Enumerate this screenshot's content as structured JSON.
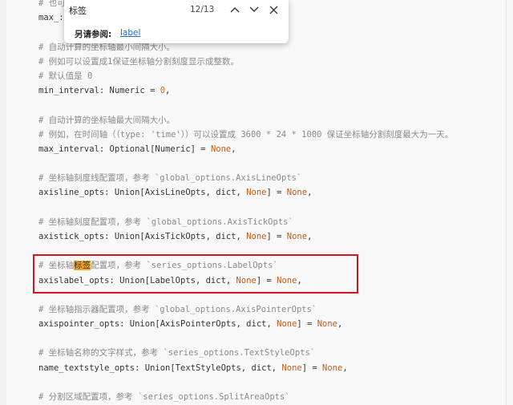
{
  "find_bar": {
    "query": "标签",
    "match_count": "12/13",
    "see_also_label": "另请参阅:",
    "see_also_link": "label"
  },
  "code": {
    "top_comment_prefix": "# 也可",
    "max_prefix": "max_:",
    "min_comment_1": "# 自动计算的坐标轴最小间隔大小。",
    "min_comment_2": "# 例如可以设置成1保证坐标轴分割刻度显示成整数。",
    "min_comment_3": "# 默认值是 0",
    "min_code": {
      "a": "min_interval: Numeric = ",
      "num": "0",
      "b": ","
    },
    "max_comment_1": "# 自动计算的坐标轴最大间隔大小。",
    "max_comment_2": "# 例如，在时间轴（（type: 'time'））可以设置成 3600 * 24 * 1000 保证坐标轴分割刻度最大为一天。",
    "max_code": {
      "a": "max_interval: Optional[Numeric] = ",
      "kw": "None",
      "b": ","
    },
    "axisline_comment": "# 坐标轴刻度线配置项，参考 `global_options.AxisLineOpts`",
    "axisline_code": {
      "a": "axisline_opts: Union[AxisLineOpts, dict, ",
      "kw1": "None",
      "b": "] = ",
      "kw2": "None",
      "c": ","
    },
    "axistick_comment": "# 坐标轴刻度配置项，参考 `global_options.AxisTickOpts`",
    "axistick_code": {
      "a": "axistick_opts: Union[AxisTickOpts, dict, ",
      "kw1": "None",
      "b": "] = ",
      "kw2": "None",
      "c": ","
    },
    "axislabel_comment": {
      "a": "# 坐标轴",
      "hl": "标签",
      "b": "配置项，参考 `series_options.LabelOpts`"
    },
    "axislabel_code": {
      "a": "axislabel_opts: Union[LabelOpts, dict, ",
      "kw1": "None",
      "b": "] = ",
      "kw2": "None",
      "c": ","
    },
    "axispointer_comment": "# 坐标轴指示器配置项，参考 `global_options.AxisPointerOpts`",
    "axispointer_code": {
      "a": "axispointer_opts: Union[AxisPointerOpts, dict, ",
      "kw1": "None",
      "b": "] = ",
      "kw2": "None",
      "c": ","
    },
    "name_style_comment": "# 坐标轴名称的文字样式，参考 `series_options.TextStyleOpts`",
    "name_style_code": {
      "a": "name_textstyle_opts: Union[TextStyleOpts, dict, ",
      "kw1": "None",
      "b": "] = ",
      "kw2": "None",
      "c": ","
    },
    "splitarea_comment": "# 分割区域配置项，参考 `series_options.SplitAreaOpts`"
  }
}
